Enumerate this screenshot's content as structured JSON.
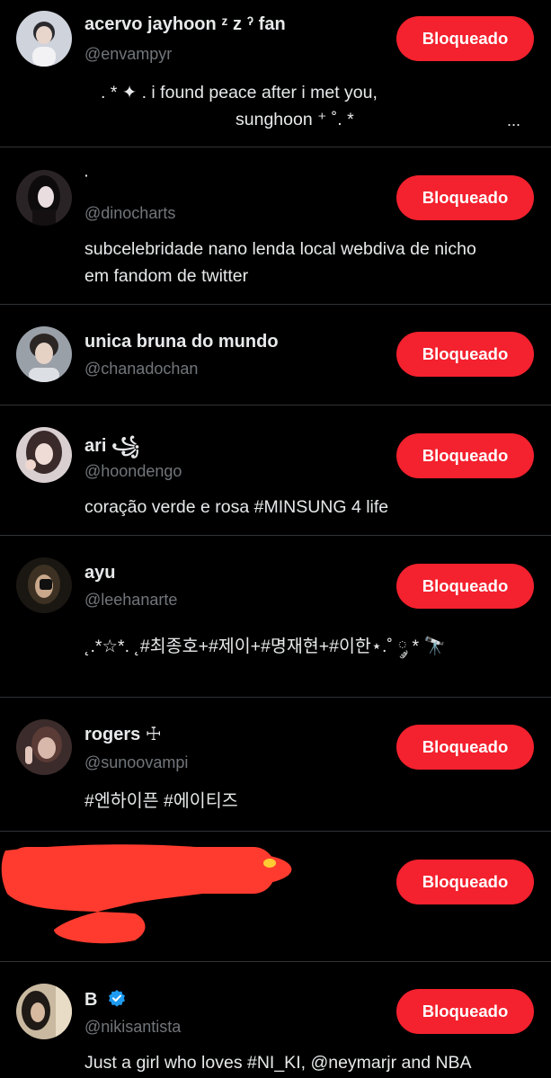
{
  "rows": [
    {
      "name": "acervo jayhoon ᶻ z ˀ fan",
      "handle": "@envampyr",
      "bio_line1": ". * ✦ .  i found peace after i met you,",
      "bio_line2": "sunghoon ⁺ ˚. *",
      "ellipsis": "...",
      "button": "Bloqueado"
    },
    {
      "name": "·",
      "handle": "@dinocharts",
      "bio_line1": "subcelebridade nano lenda local webdiva de nicho",
      "bio_line2": "em fandom de twitter",
      "button": "Bloqueado"
    },
    {
      "name": "unica bruna do mundo",
      "handle": "@chanadochan",
      "button": "Bloqueado"
    },
    {
      "name": "ari ꧁",
      "handle": "@hoondengo",
      "bio_line1": "coração verde e rosa #MINSUNG 4 life",
      "button": "Bloqueado"
    },
    {
      "name": "ayu",
      "handle": "@leehanarte",
      "bio_line1": "˛.*☆*. ˛#최종호+#제이+#명재현+#이한⋆.˚ ༘ * 🔭",
      "button": "Bloqueado"
    },
    {
      "name": "rogers ☩",
      "handle": "@sunoovampi",
      "bio_line1": "#엔하이픈 #에이티즈",
      "button": "Bloqueado"
    },
    {
      "button": "Bloqueado"
    },
    {
      "name": "B",
      "handle": "@nikisantista",
      "bio_line1": "Just a girl who loves #NI_KI, @neymarjr and NBA",
      "button": "Bloqueado"
    }
  ],
  "colors": {
    "accent": "#f4212e",
    "background": "#000000",
    "verified": "#1d9bf0",
    "redaction": "#ff3b2f"
  },
  "icons": {
    "verified": "verified-badge-icon"
  }
}
